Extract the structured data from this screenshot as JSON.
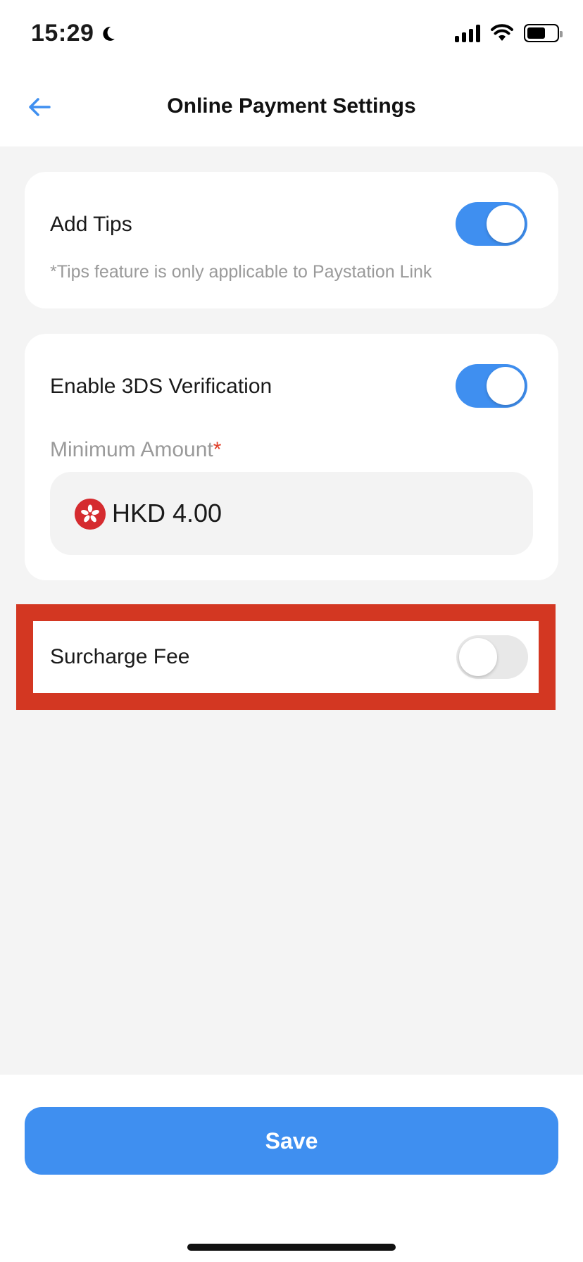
{
  "status_bar": {
    "time": "15:29"
  },
  "header": {
    "title": "Online Payment Settings"
  },
  "tips": {
    "label": "Add Tips",
    "enabled": true,
    "hint": "*Tips feature is only applicable to Paystation Link"
  },
  "verification": {
    "label": "Enable 3DS Verification",
    "enabled": true,
    "min_amount_label": "Minimum Amount",
    "required_mark": "*",
    "amount_value": "HKD 4.00"
  },
  "surcharge": {
    "label": "Surcharge Fee",
    "enabled": false
  },
  "footer": {
    "save_label": "Save"
  },
  "colors": {
    "accent": "#3f8ff0",
    "highlight": "#d33722",
    "hk_flag": "#d52b2f"
  },
  "icons": {
    "back": "arrow-left-icon",
    "moon": "moon-icon",
    "signal": "cellular-signal-icon",
    "wifi": "wifi-icon",
    "battery": "battery-icon",
    "flag": "hong-kong-flag-icon"
  }
}
